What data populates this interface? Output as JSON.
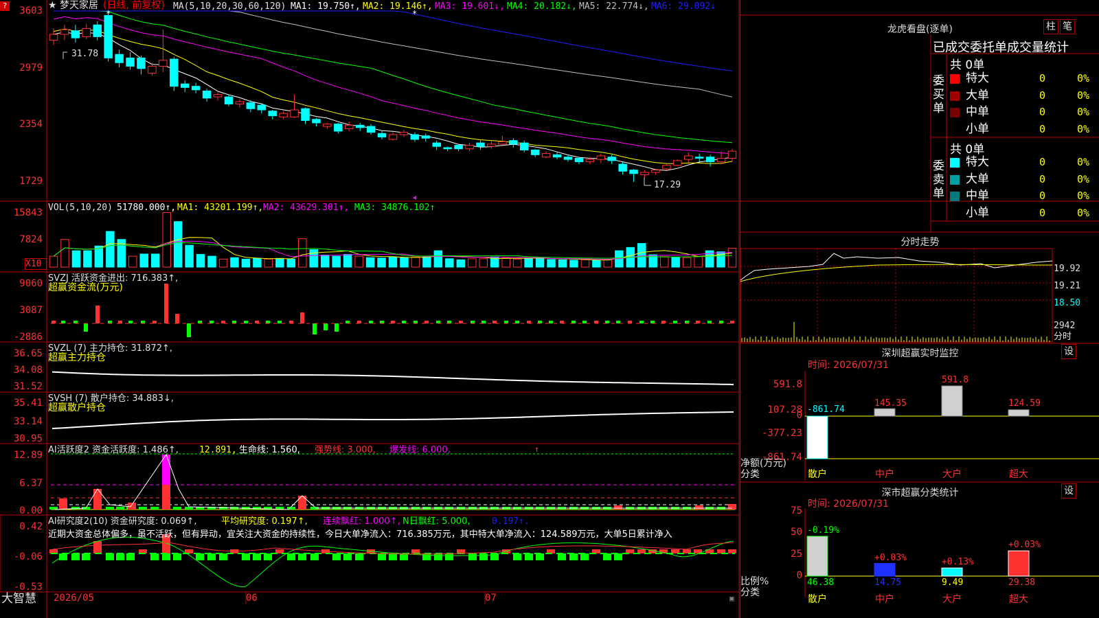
{
  "main": {
    "title": "★ 梦天家居",
    "period": "(日线, 前复权)",
    "ma_label": "MA(5,10,20,30,60,120)",
    "ma1": "MA1: 19.750↑,",
    "ma2": "MA2: 19.146↑,",
    "ma3": "MA3: 19.601↓,",
    "ma4": "MA4: 20.182↓,",
    "ma5": "MA5: 22.774↓,",
    "ma6": "MA6: 29.092↓",
    "yticks": [
      "3603",
      "2979",
      "2354",
      "1729"
    ],
    "high_mark": "31.78",
    "low_mark": "17.29"
  },
  "vol": {
    "label": "VOL(5,10,20)",
    "value": "51780.000↑,",
    "ma1": "MA1: 43201.199↑,",
    "ma2": "MA2: 43629.301↑,",
    "ma3": "MA3: 34876.102↑",
    "yticks": [
      "15843",
      "7824"
    ],
    "unit": "X10"
  },
  "svzj": {
    "label": "SVZJ  活跃资金进出: 716.383↑,",
    "sub": "超赢资金流(万元)",
    "yticks": [
      "9060",
      "3087",
      "-2886"
    ]
  },
  "svzl": {
    "label": "SVZL (7) 主力持仓: 31.872↑,",
    "sub": "超赢主力持仓",
    "yticks": [
      "36.65",
      "34.08",
      "31.52"
    ]
  },
  "svsh": {
    "label": "SVSH (7) 散户持仓: 34.883↓,",
    "sub": "超赢散户持仓",
    "yticks": [
      "35.41",
      "33.14",
      "30.95"
    ]
  },
  "ai1": {
    "label": "AI活跃度2 资金活跃度: 1.486↑,",
    "v2": "12.891,",
    "v3": "生命线: 1.560,",
    "v4": "强势线: 3.000,",
    "v5": "爆发线: 6.000,",
    "yticks": [
      "12.89",
      "6.37",
      "0.00"
    ]
  },
  "ai2": {
    "label": "AI研究度2(10) 资金研究度: 0.069↑,",
    "v2": "平均研究度: 0.197↑,",
    "v3": "连续飘红: 1.000↑,",
    "v4": "N日飘红: 5.000,",
    "v5": "0.197↑.",
    "note": "近期大资金总体偏多，虽不活跃，但有异动，宜关注大资金的持续性，今日大单净流入：716.385万元，其中特大单净流入：124.589万元，大单5日累计净入",
    "yticks": [
      "0.42",
      "-0.06",
      "-0.53"
    ]
  },
  "xaxis": {
    "brand": "大智慧",
    "labels": [
      "2026/05",
      "06",
      "07"
    ]
  },
  "right": {
    "dragon_title": "龙虎看盘(逐单)",
    "btn_bar": "柱",
    "btn_stroke": "笔",
    "stats_title": "已成交委托单成交量统计",
    "buy": {
      "side": "委买单",
      "total": "共 0单",
      "rows": [
        {
          "name": "特大",
          "count": "0",
          "pct": "0%",
          "color": "#ff0000"
        },
        {
          "name": "大单",
          "count": "0",
          "pct": "0%",
          "color": "#a00000"
        },
        {
          "name": "中单",
          "count": "0",
          "pct": "0%",
          "color": "#7a0000"
        },
        {
          "name": "小单",
          "count": "0",
          "pct": "0%",
          "color": ""
        }
      ]
    },
    "sell": {
      "side": "委卖单",
      "total": "共 0单",
      "rows": [
        {
          "name": "特大",
          "count": "0",
          "pct": "0%",
          "color": "#00ffff"
        },
        {
          "name": "大单",
          "count": "0",
          "pct": "0%",
          "color": "#00a0a0"
        },
        {
          "name": "中单",
          "count": "0",
          "pct": "0%",
          "color": "#007a7a"
        },
        {
          "name": "小单",
          "count": "0",
          "pct": "0%",
          "color": ""
        }
      ]
    },
    "intraday": {
      "title": "分时走势",
      "yticks": [
        "19.92",
        "19.21",
        "18.50"
      ],
      "vol_top": "2942",
      "vol_label": "分时"
    },
    "sz_monitor": {
      "title": "深圳超赢实时监控",
      "btn": "设",
      "time": "时间: 2026/07/31",
      "yticks": [
        "591.8",
        "107.28",
        "0",
        "-377.23",
        "-861.74"
      ],
      "bar_labels": [
        "-861.74",
        "145.35",
        "591.8",
        "124.59"
      ],
      "axis_name": "净额(万元)",
      "axis_cat": "分类",
      "cats": [
        "散户",
        "中户",
        "大户",
        "超大"
      ]
    },
    "sz_stats": {
      "title": "深市超赢分类统计",
      "btn": "设",
      "time": "时间: 2026/07/31",
      "yticks": [
        "75",
        "50",
        "25",
        "0"
      ],
      "top_labels": [
        "-0.19%",
        "+0.03%",
        "+0.13%",
        "+0.03%"
      ],
      "bottom_vals": [
        "46.38",
        "14.75",
        "9.49",
        "29.38"
      ],
      "axis_name": "比例%",
      "axis_cat": "分类",
      "cats": [
        "散户",
        "中户",
        "大户",
        "超大"
      ]
    }
  },
  "chart_data": [
    {
      "type": "candlestick",
      "title": "梦天家居",
      "subtitle": "(日线, 前复权)",
      "ylim": [
        17.29,
        31.78
      ],
      "high": 31.78,
      "low": 17.29,
      "series": [
        {
          "name": "MA1",
          "value": 19.75
        },
        {
          "name": "MA2",
          "value": 19.146
        },
        {
          "name": "MA3",
          "value": 19.601
        },
        {
          "name": "MA4",
          "value": 20.182
        },
        {
          "name": "MA5",
          "value": 22.774
        },
        {
          "name": "MA6",
          "value": 29.092
        }
      ],
      "candles": [
        [
          29.3,
          29.8,
          28.9,
          30.3
        ],
        [
          29.8,
          30.2,
          29.3,
          30.6
        ],
        [
          30.1,
          29.5,
          29.1,
          30.6
        ],
        [
          29.6,
          30.3,
          29.4,
          30.7
        ],
        [
          30.6,
          29.6,
          29.3,
          30.9
        ],
        [
          31.4,
          27.8,
          27.5,
          31.8
        ],
        [
          28.1,
          27.4,
          27.0,
          28.5
        ],
        [
          27.8,
          27.1,
          26.8,
          28.3
        ],
        [
          27.8,
          26.9,
          26.4,
          28.0
        ],
        [
          26.5,
          27.1,
          26.3,
          27.4
        ],
        [
          27.1,
          27.6,
          26.6,
          30.2
        ],
        [
          27.7,
          25.4,
          25.0,
          27.9
        ],
        [
          25.6,
          25.3,
          24.9,
          25.9
        ],
        [
          25.4,
          25.1,
          24.8,
          25.7
        ],
        [
          25.0,
          24.4,
          24.1,
          25.2
        ],
        [
          24.5,
          24.7,
          24.2,
          24.9
        ],
        [
          24.5,
          23.9,
          23.7,
          24.7
        ],
        [
          23.9,
          24.1,
          23.6,
          24.3
        ],
        [
          24.0,
          23.5,
          23.2,
          24.2
        ],
        [
          23.8,
          23.4,
          23.1,
          23.9
        ],
        [
          23.3,
          22.9,
          22.6,
          23.4
        ],
        [
          22.8,
          23.1,
          22.6,
          23.3
        ],
        [
          22.8,
          23.4,
          22.7,
          24.7
        ],
        [
          23.5,
          22.5,
          22.2,
          23.6
        ],
        [
          22.6,
          22.3,
          22.0,
          22.7
        ],
        [
          22.0,
          22.2,
          21.8,
          22.3
        ],
        [
          22.2,
          21.6,
          21.4,
          22.3
        ],
        [
          21.8,
          22.1,
          21.6,
          22.4
        ],
        [
          22.1,
          21.9,
          21.6,
          22.3
        ],
        [
          22.0,
          21.5,
          21.3,
          22.2
        ],
        [
          21.4,
          21.1,
          20.9,
          21.6
        ],
        [
          20.9,
          21.3,
          20.8,
          21.5
        ],
        [
          21.3,
          21.5,
          21.1,
          21.7
        ],
        [
          21.3,
          20.9,
          20.7,
          21.5
        ],
        [
          21.2,
          21.0,
          20.7,
          21.4
        ],
        [
          20.6,
          20.3,
          20.0,
          20.8
        ],
        [
          20.2,
          20.1,
          19.9,
          20.3
        ],
        [
          20.4,
          20.1,
          19.9,
          20.5
        ],
        [
          20.1,
          20.4,
          19.9,
          20.6
        ],
        [
          20.6,
          20.3,
          20.0,
          20.8
        ],
        [
          20.3,
          20.5,
          20.1,
          20.8
        ],
        [
          20.5,
          20.7,
          20.3,
          21.2
        ],
        [
          20.8,
          20.5,
          20.2,
          21.0
        ],
        [
          20.6,
          20.0,
          19.8,
          20.8
        ],
        [
          20.0,
          19.6,
          19.4,
          20.1
        ],
        [
          19.4,
          19.7,
          19.3,
          19.9
        ],
        [
          19.6,
          19.4,
          19.2,
          19.8
        ],
        [
          19.4,
          19.2,
          19.0,
          19.6
        ],
        [
          19.3,
          19.0,
          18.8,
          19.4
        ],
        [
          19.0,
          19.2,
          18.8,
          19.4
        ],
        [
          19.2,
          19.5,
          18.9,
          19.7
        ],
        [
          19.4,
          19.1,
          18.8,
          19.6
        ],
        [
          18.8,
          18.2,
          17.9,
          19.0
        ],
        [
          18.3,
          18.0,
          17.29,
          18.4
        ],
        [
          17.9,
          18.1,
          17.7,
          18.3
        ],
        [
          18.1,
          18.3,
          17.9,
          18.4
        ],
        [
          18.4,
          18.7,
          18.3,
          18.8
        ],
        [
          18.7,
          19.1,
          18.6,
          19.2
        ],
        [
          19.2,
          19.5,
          18.9,
          19.8
        ],
        [
          19.4,
          19.3,
          19.0,
          19.7
        ],
        [
          19.4,
          19.0,
          18.6,
          19.6
        ],
        [
          19.0,
          19.3,
          18.8,
          19.9
        ],
        [
          19.3,
          19.9,
          19.0,
          20.1
        ]
      ]
    },
    {
      "type": "bar",
      "title": "VOL(5,10,20)",
      "ylim": [
        0,
        15843
      ],
      "values": [
        51780
      ],
      "series": [
        {
          "name": "MA1",
          "value": 43201.199
        },
        {
          "name": "MA2",
          "value": 43629.301
        },
        {
          "name": "MA3",
          "value": 34876.102
        }
      ],
      "bars": [
        [
          3000,
          "up"
        ],
        [
          7600,
          "up"
        ],
        [
          4500,
          "dn"
        ],
        [
          4500,
          "dn"
        ],
        [
          5800,
          "dn"
        ],
        [
          9800,
          "dn"
        ],
        [
          7600,
          "dn"
        ],
        [
          3000,
          "up"
        ],
        [
          3600,
          "dn"
        ],
        [
          3600,
          "dn"
        ],
        [
          15000,
          "up"
        ],
        [
          12500,
          "dn"
        ],
        [
          6000,
          "dn"
        ],
        [
          3500,
          "dn"
        ],
        [
          3000,
          "dn"
        ],
        [
          2200,
          "up"
        ],
        [
          2600,
          "dn"
        ],
        [
          2200,
          "dn"
        ],
        [
          2400,
          "dn"
        ],
        [
          2200,
          "up"
        ],
        [
          2400,
          "dn"
        ],
        [
          2200,
          "dn"
        ],
        [
          7800,
          "up"
        ],
        [
          4800,
          "dn"
        ],
        [
          3300,
          "dn"
        ],
        [
          3000,
          "dn"
        ],
        [
          3500,
          "dn"
        ],
        [
          3000,
          "up"
        ],
        [
          2600,
          "dn"
        ],
        [
          2500,
          "dn"
        ],
        [
          2800,
          "dn"
        ],
        [
          2600,
          "dn"
        ],
        [
          2800,
          "up"
        ],
        [
          2800,
          "dn"
        ],
        [
          4500,
          "dn"
        ],
        [
          2300,
          "dn"
        ],
        [
          2000,
          "dn"
        ],
        [
          2300,
          "up"
        ],
        [
          2300,
          "up"
        ],
        [
          2800,
          "dn"
        ],
        [
          2500,
          "up"
        ],
        [
          2200,
          "up"
        ],
        [
          2400,
          "dn"
        ],
        [
          2600,
          "dn"
        ],
        [
          2100,
          "dn"
        ],
        [
          2000,
          "dn"
        ],
        [
          1900,
          "dn"
        ],
        [
          2000,
          "up"
        ],
        [
          1800,
          "dn"
        ],
        [
          2000,
          "up"
        ],
        [
          4500,
          "dn"
        ],
        [
          5400,
          "dn"
        ],
        [
          6500,
          "dn"
        ],
        [
          3400,
          "dn"
        ],
        [
          2900,
          "up"
        ],
        [
          2700,
          "dn"
        ],
        [
          2600,
          "up"
        ],
        [
          3000,
          "up"
        ],
        [
          4500,
          "dn"
        ],
        [
          4200,
          "dn"
        ],
        [
          5200,
          "up"
        ]
      ]
    },
    {
      "type": "bar",
      "title": "深圳超赢实时监控",
      "ylabel": "净额(万元)",
      "categories": [
        "散户",
        "中户",
        "大户",
        "超大"
      ],
      "values": [
        -861.74,
        145.35,
        591.8,
        124.59
      ],
      "ylim": [
        -861.74,
        591.8
      ]
    },
    {
      "type": "bar",
      "title": "深市超赢分类统计",
      "ylabel": "比例%",
      "categories": [
        "散户",
        "中户",
        "大户",
        "超大"
      ],
      "values": [
        46.38,
        14.75,
        9.49,
        29.38
      ],
      "ylim": [
        0,
        75
      ]
    }
  ]
}
